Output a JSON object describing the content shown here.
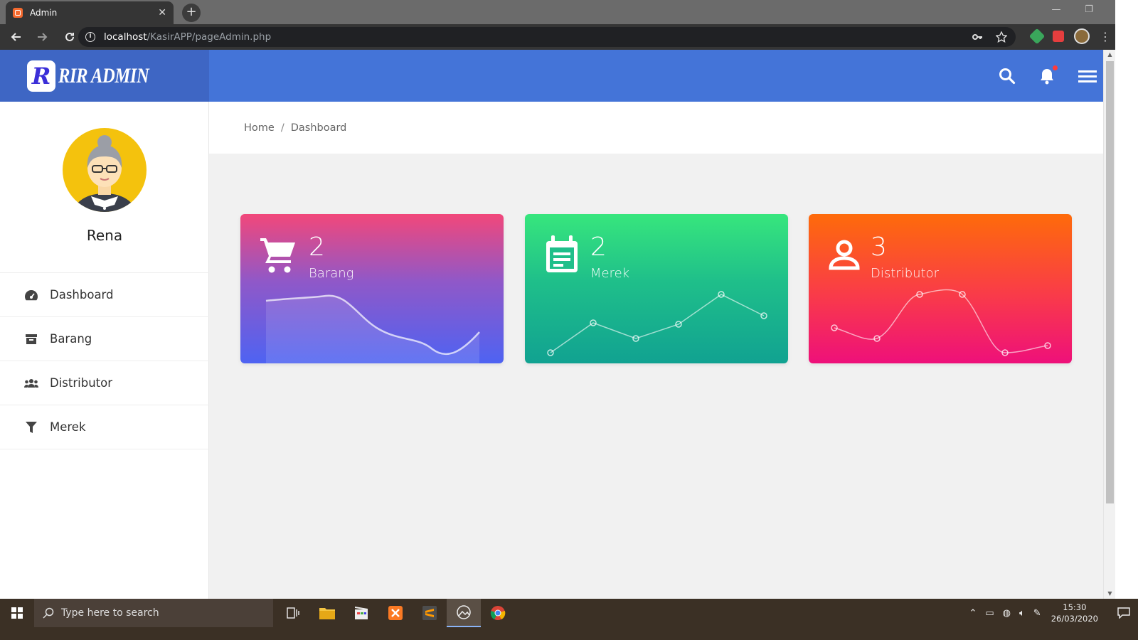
{
  "browser": {
    "tab_title": "Admin",
    "tab_close": "✕",
    "new_tab": "+",
    "url_host": "localhost",
    "url_path": "/KasirAPP/pageAdmin.php",
    "win_min": "—",
    "win_restore": "❐",
    "win_close": "✕"
  },
  "header": {
    "logo_letter": "R",
    "logo_text": "RIR ADMIN"
  },
  "sidebar": {
    "user_name": "Rena",
    "items": [
      {
        "label": "Dashboard",
        "icon": "dashboard-gauge-icon"
      },
      {
        "label": "Barang",
        "icon": "archive-box-icon"
      },
      {
        "label": "Distributor",
        "icon": "users-group-icon"
      },
      {
        "label": "Merek",
        "icon": "filter-funnel-icon"
      }
    ]
  },
  "breadcrumb": {
    "home": "Home",
    "separator": "/",
    "current": "Dashboard"
  },
  "cards": [
    {
      "count": "2",
      "label": "Barang",
      "icon": "shopping-cart-icon"
    },
    {
      "count": "2",
      "label": "Merek",
      "icon": "calendar-note-icon"
    },
    {
      "count": "3",
      "label": "Distributor",
      "icon": "user-icon"
    }
  ],
  "taskbar": {
    "search_placeholder": "Type here to search",
    "time": "15:30",
    "date": "26/03/2020"
  },
  "colors": {
    "header_blue": "#4474d8",
    "logo_area_blue": "#3e66c4",
    "card1_gradient": [
      "#f2477a",
      "#9058c8",
      "#4e63f2"
    ],
    "card2_gradient": [
      "#37e67d",
      "#1fbf8a",
      "#11a291"
    ],
    "card3_gradient": [
      "#fe6b0a",
      "#f93a4a",
      "#ee107a"
    ]
  }
}
